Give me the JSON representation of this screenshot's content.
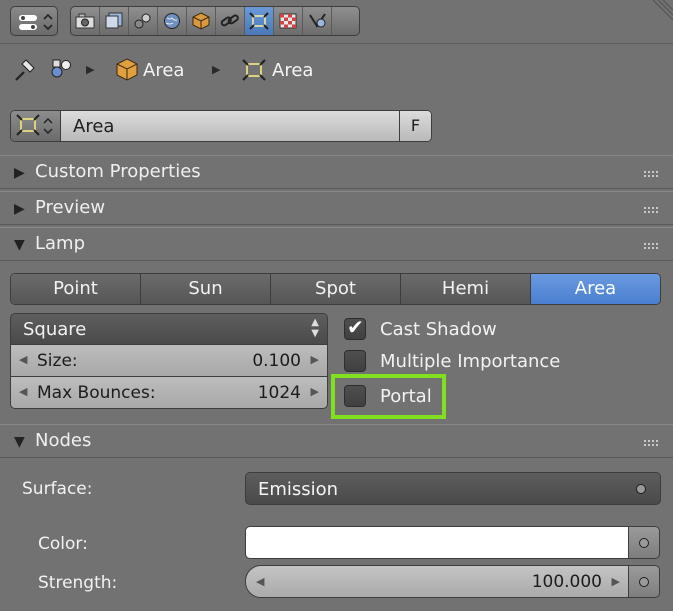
{
  "header": {
    "tabs": [
      {
        "icon": "render-camera-icon"
      },
      {
        "icon": "render-layers-icon"
      },
      {
        "icon": "scene-icon"
      },
      {
        "icon": "world-icon"
      },
      {
        "icon": "object-icon"
      },
      {
        "icon": "constraints-link-icon"
      },
      {
        "icon": "lamp-data-icon",
        "active": true
      },
      {
        "icon": "texture-icon"
      },
      {
        "icon": "material-icon"
      }
    ]
  },
  "breadcrumb": {
    "object_name": "Area",
    "data_name": "Area"
  },
  "datablock": {
    "name": "Area",
    "fake_user": "F"
  },
  "panels": {
    "custom_properties": "Custom Properties",
    "preview": "Preview",
    "lamp": "Lamp",
    "nodes": "Nodes"
  },
  "lamp": {
    "types": [
      "Point",
      "Sun",
      "Spot",
      "Hemi",
      "Area"
    ],
    "selected_type": "Area",
    "shape": "Square",
    "size_label": "Size:",
    "size_value": "0.100",
    "bounces_label": "Max Bounces:",
    "bounces_value": "1024",
    "cast_shadow": {
      "label": "Cast Shadow",
      "checked": true
    },
    "multiple_importance": {
      "label": "Multiple Importance",
      "checked": false
    },
    "portal": {
      "label": "Portal",
      "checked": false
    }
  },
  "nodes": {
    "surface_label": "Surface:",
    "surface_value": "Emission",
    "color_label": "Color:",
    "color_value": "#ffffff",
    "strength_label": "Strength:",
    "strength_value": "100.000"
  },
  "colors": {
    "highlight": "#80e020",
    "active_tab": "#5a8bd0"
  }
}
